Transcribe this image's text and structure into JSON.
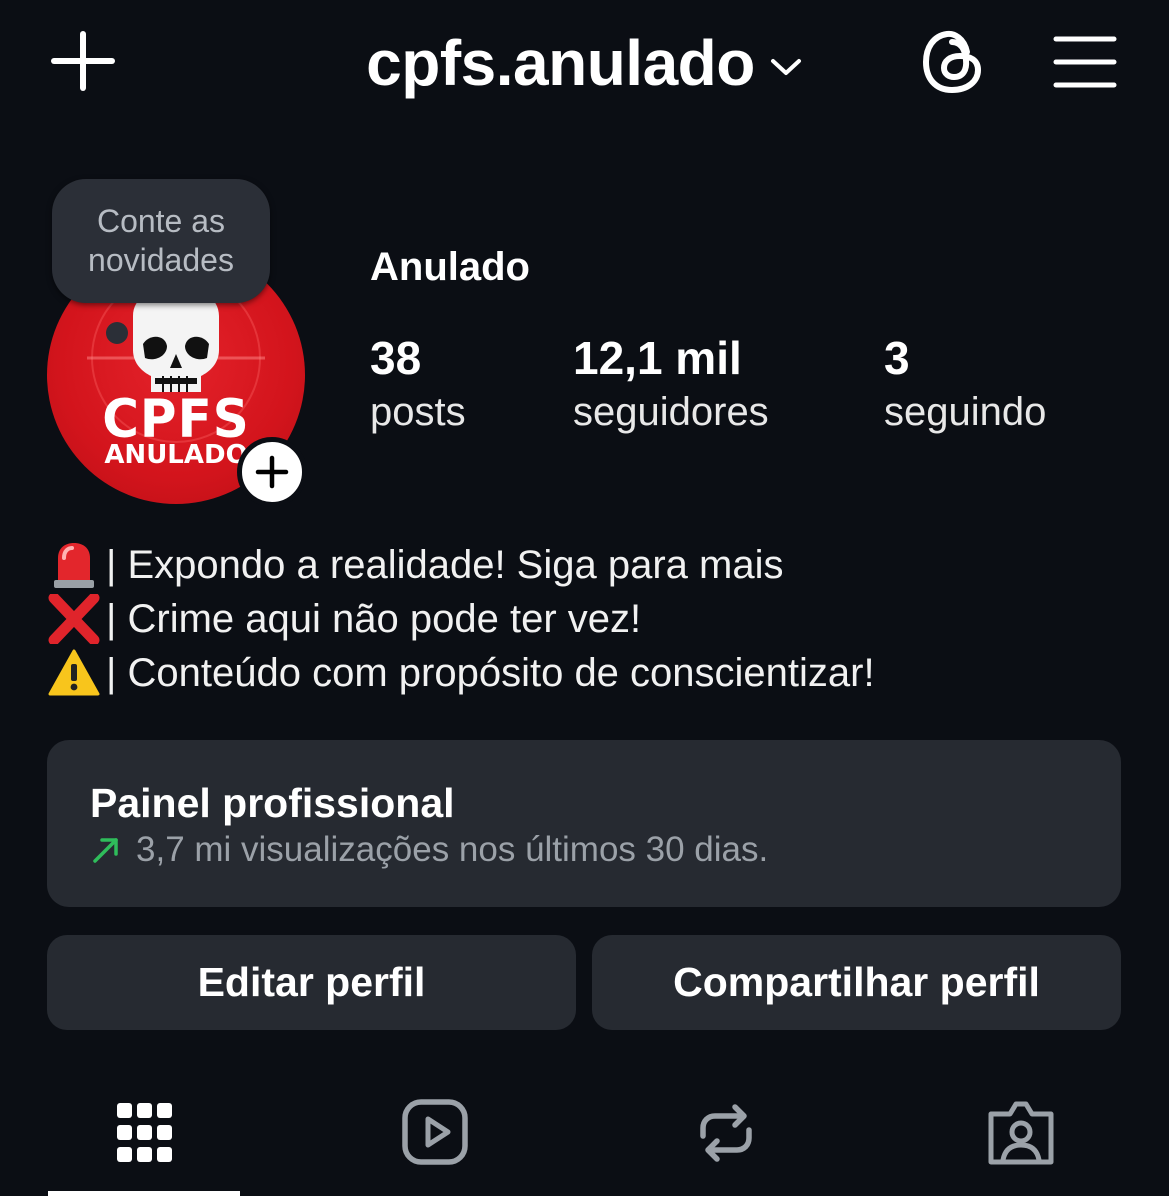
{
  "header": {
    "username": "cpfs.anulado",
    "icons": [
      "plus-icon",
      "chevron-down-icon",
      "threads-icon",
      "menu-icon"
    ]
  },
  "note": {
    "line1": "Conte as",
    "line2": "novidades"
  },
  "avatar": {
    "text_line1": "CPFS",
    "text_line2": "ANULADO",
    "background_color": "#d3141c"
  },
  "profile": {
    "display_name": "Anulado",
    "stats": [
      {
        "value": "38",
        "label": "posts"
      },
      {
        "value": "12,1 mil",
        "label": "seguidores"
      },
      {
        "value": "3",
        "label": "seguindo"
      }
    ]
  },
  "bio": {
    "lines": [
      {
        "icon": "siren-icon",
        "text": "| Expondo a realidade! Siga para mais"
      },
      {
        "icon": "cross-mark-icon",
        "text": "| Crime aqui não pode ter vez!"
      },
      {
        "icon": "warning-icon",
        "text": "| Conteúdo com propósito de conscientizar!"
      }
    ]
  },
  "professional_dashboard": {
    "title": "Painel profissional",
    "subtitle": "3,7 mi visualizações nos últimos 30 dias.",
    "trend_color": "#2fbd5b"
  },
  "buttons": {
    "edit": "Editar perfil",
    "share": "Compartilhar perfil"
  },
  "tabs": {
    "items": [
      "grid-icon",
      "reels-icon",
      "reposts-icon",
      "tagged-icon"
    ],
    "active": "grid-icon"
  },
  "colors": {
    "background": "#0b0e14",
    "card": "#262a31",
    "text": "#ffffff",
    "muted": "#9ba1a8"
  }
}
